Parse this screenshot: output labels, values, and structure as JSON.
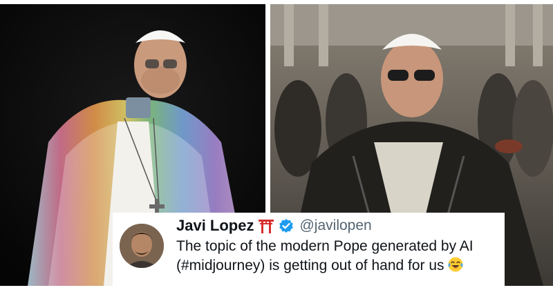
{
  "photos": {
    "left_alt": "",
    "right_alt": ""
  },
  "tweet": {
    "display_name": "Javi Lopez",
    "handle": "@javilopen",
    "text": "The topic of the modern Pope generated by AI (#midjourney) is getting out of hand for us",
    "emoji_icon": "tears-of-joy-icon",
    "name_emoji_icon": "torii-gate-icon",
    "verified_icon": "verified-badge-icon",
    "colors": {
      "verified": "#1d9bf0",
      "text": "#0f1419",
      "handle": "#536471",
      "torii": "#d72d2d"
    }
  }
}
